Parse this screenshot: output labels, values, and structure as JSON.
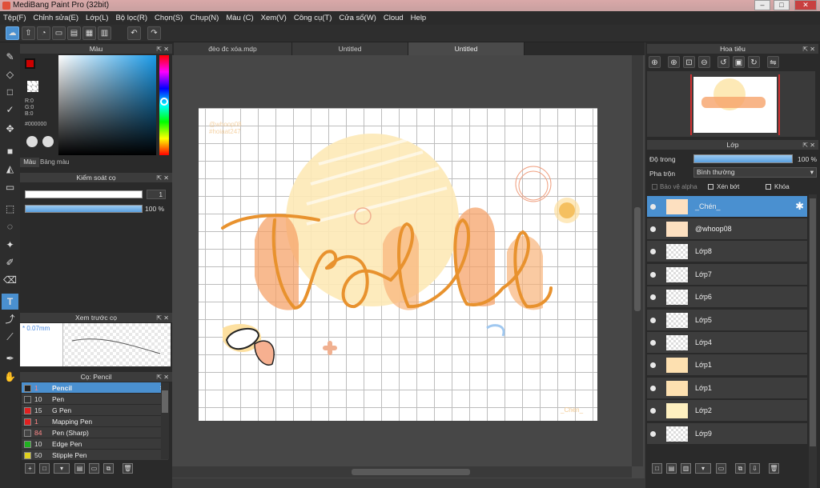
{
  "window": {
    "title": "MediBang Paint Pro (32bit)",
    "min": "–",
    "max": "□",
    "close": "✕"
  },
  "menu": [
    "Tệp(F)",
    "Chỉnh sửa(E)",
    "Lớp(L)",
    "Bộ lọc(R)",
    "Chọn(S)",
    "Chụp(N)",
    "Màu (C)",
    "Xem(V)",
    "Công cụ(T)",
    "Cửa sổ(W)",
    "Cloud",
    "Help"
  ],
  "color_panel": {
    "title": "Màu",
    "r": "R:0",
    "g": "G:0",
    "b": "B:0",
    "hex": "#000000",
    "tab_color": "Màu",
    "tab_palette": "Bảng màu"
  },
  "brush_control": {
    "title": "Kiểm soát cọ",
    "size": "1",
    "opacity": "100 %"
  },
  "brush_preview": {
    "title": "Xem trước cọ",
    "size": "* 0.07mm"
  },
  "brush_list": {
    "title": "Cọ: Pencil",
    "items": [
      {
        "size": "1",
        "name": "Pencil",
        "color": "#222222"
      },
      {
        "size": "10",
        "name": "Pen",
        "color": "#333333"
      },
      {
        "size": "15",
        "name": "G Pen",
        "color": "#e02020"
      },
      {
        "size": "1",
        "name": "Mapping Pen",
        "color": "#e02020"
      },
      {
        "size": "84",
        "name": "Pen (Sharp)",
        "color": "#444444"
      },
      {
        "size": "10",
        "name": "Edge Pen",
        "color": "#20b020"
      },
      {
        "size": "50",
        "name": "Stipple Pen",
        "color": "#e0d020"
      }
    ]
  },
  "doc_tabs": [
    "đèo đc xóa.mdp",
    "Untitled",
    "Untitled"
  ],
  "navigator": {
    "title": "Hoa tiêu"
  },
  "layers_panel": {
    "title": "Lớp",
    "opacity_label": "Độ trong",
    "opacity_value": "100 %",
    "blend_label": "Pha trộn",
    "blend_value": "Bình thường",
    "protect_alpha": "Bảo vệ alpha",
    "clipping": "Xén bớt",
    "lock": "Khóa",
    "layers": [
      "_Chén_",
      "@whoop08",
      "Lớp8",
      "Lớp7",
      "Lớp6",
      "Lớp5",
      "Lớp4",
      "Lớp1",
      "Lớp1",
      "Lớp2",
      "Lớp9"
    ]
  },
  "canvas_text": {
    "watermark1": "@whoop08",
    "watermark2": "#hoiaat247",
    "signature": "_Chén_"
  },
  "colors": {
    "accent": "#4a90d0",
    "main": "#e8922e"
  }
}
